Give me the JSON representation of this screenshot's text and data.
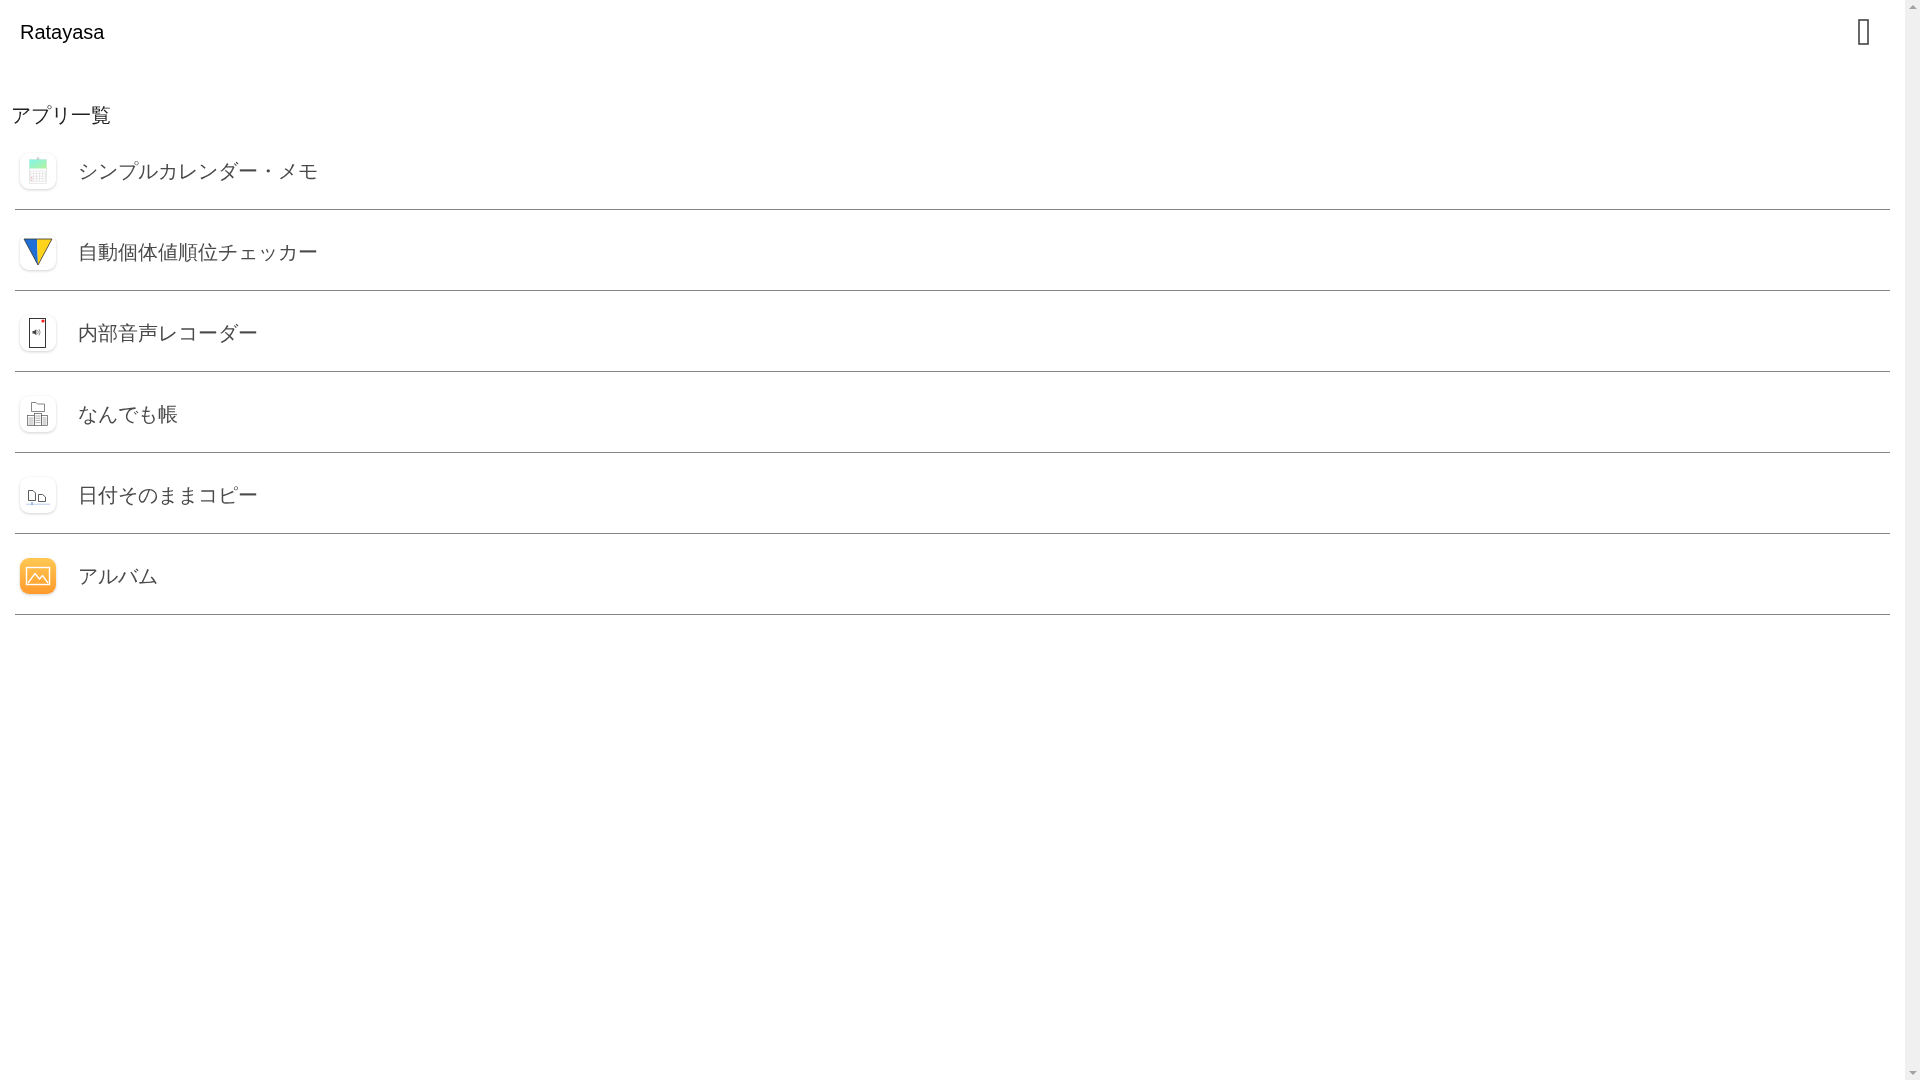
{
  "header": {
    "title": "Ratayasa"
  },
  "app_list": {
    "heading": "アプリ一覧",
    "items": [
      {
        "name": "シンプルカレンダー・メモ"
      },
      {
        "name": "自動個体値順位チェッカー"
      },
      {
        "name": "内部音声レコーダー"
      },
      {
        "name": "なんでも帳"
      },
      {
        "name": "日付そのままコピー"
      },
      {
        "name": "アルバム"
      }
    ]
  }
}
